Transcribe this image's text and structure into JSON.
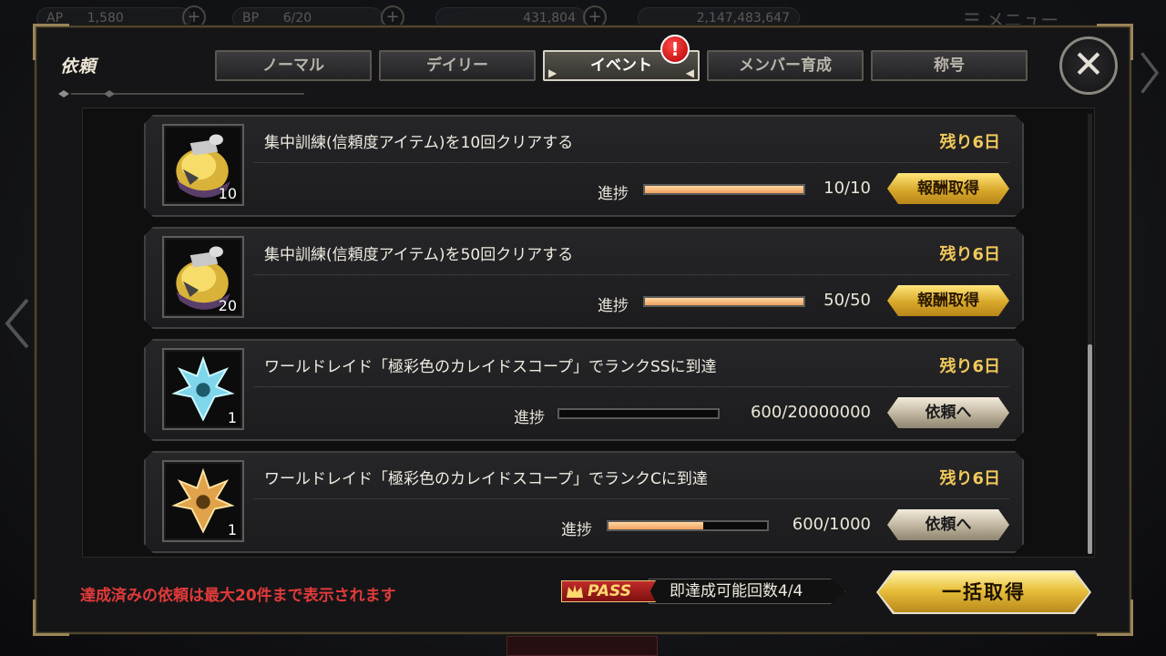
{
  "topbar": {
    "items": [
      {
        "label": "AP",
        "value": "1,580"
      },
      {
        "label": "BP",
        "value": "6/20"
      },
      {
        "label": "",
        "value": "431,804"
      },
      {
        "label": "",
        "value": "2,147,483,647"
      }
    ],
    "menu_label": "メニュー"
  },
  "panel": {
    "title": "依頼"
  },
  "tabs": [
    {
      "label": "ノーマル",
      "active": false
    },
    {
      "label": "デイリー",
      "active": false
    },
    {
      "label": "イベント",
      "active": true
    },
    {
      "label": "メンバー育成",
      "active": false
    },
    {
      "label": "称号",
      "active": false
    }
  ],
  "alert_badge": "!",
  "close_label": "✕",
  "quests": [
    {
      "title": "集中訓練(信頼度アイテム)を10回クリアする",
      "remaining": "残り6日",
      "progress_label": "進捗",
      "progress_text": "10/10",
      "progress_fraction": 1.0,
      "button": "報酬取得",
      "button_type": "claim",
      "icon": "trust-potion-icon",
      "count": "10"
    },
    {
      "title": "集中訓練(信頼度アイテム)を50回クリアする",
      "remaining": "残り6日",
      "progress_label": "進捗",
      "progress_text": "50/50",
      "progress_fraction": 1.0,
      "button": "報酬取得",
      "button_type": "claim",
      "icon": "trust-potion-icon",
      "count": "20"
    },
    {
      "title": "ワールドレイド「極彩色のカレイドスコープ」でランクSSに到達",
      "remaining": "残り6日",
      "progress_label": "進捗",
      "progress_text": "600/20000000",
      "progress_fraction": 3e-05,
      "button": "依頼へ",
      "button_type": "go",
      "icon": "blue-crest-icon",
      "count": "1"
    },
    {
      "title": "ワールドレイド「極彩色のカレイドスコープ」でランクCに到達",
      "remaining": "残り6日",
      "progress_label": "進捗",
      "progress_text": "600/1000",
      "progress_fraction": 0.6,
      "button": "依頼へ",
      "button_type": "go",
      "icon": "gold-crest-icon",
      "count": "1"
    }
  ],
  "footer": {
    "note": "達成済みの依頼は最大20件まで表示されます",
    "pass_label": "PASS",
    "pass_text": "即達成可能回数4/4",
    "bulk_button": "一括取得"
  },
  "colors": {
    "accent_gold": "#f1c85a",
    "warning_red": "#e23a3a",
    "progress_fill": "#f0a060"
  }
}
